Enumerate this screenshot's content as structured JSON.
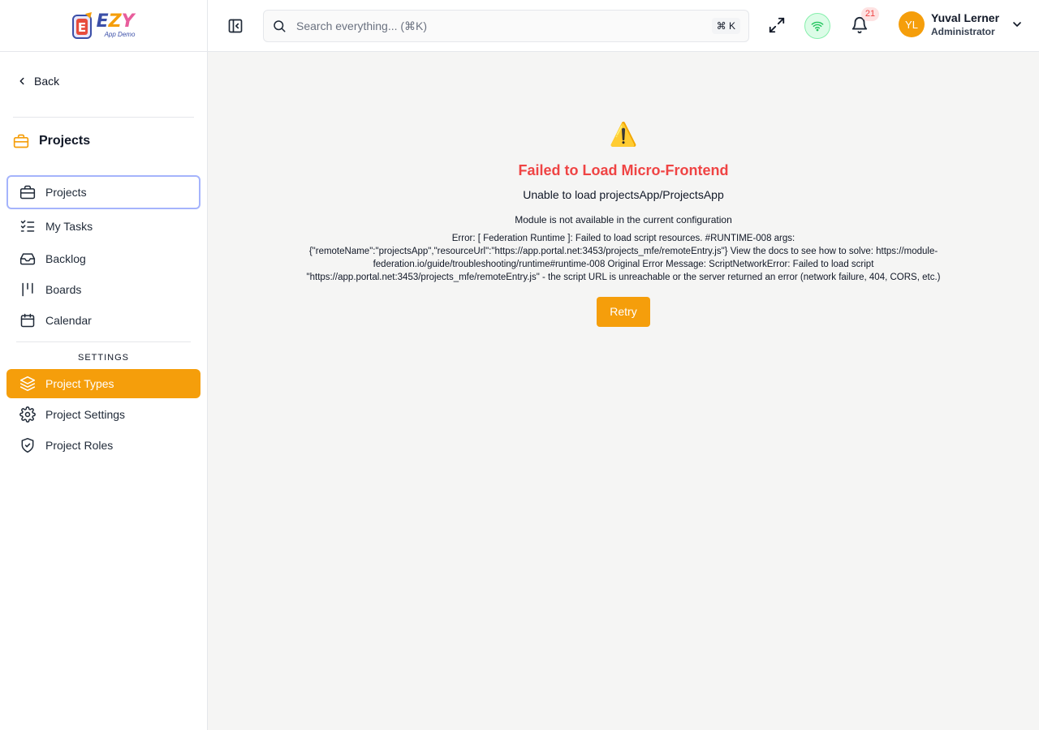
{
  "logo": {
    "word_e": "E",
    "word_z": "Z",
    "word_y": "Y",
    "subtitle": "App Demo",
    "mark": "E"
  },
  "sidebar": {
    "back_label": "Back",
    "section_title": "Projects",
    "items": [
      {
        "label": "Projects",
        "icon": "briefcase-icon"
      },
      {
        "label": "My Tasks",
        "icon": "list-checks-icon"
      },
      {
        "label": "Backlog",
        "icon": "inbox-icon"
      },
      {
        "label": "Boards",
        "icon": "kanban-icon"
      },
      {
        "label": "Calendar",
        "icon": "calendar-icon"
      }
    ],
    "settings_label": "SETTINGS",
    "settings_items": [
      {
        "label": "Project Types",
        "icon": "layers-icon"
      },
      {
        "label": "Project Settings",
        "icon": "gear-icon"
      },
      {
        "label": "Project Roles",
        "icon": "shield-check-icon"
      }
    ]
  },
  "header": {
    "search_placeholder": "Search everything... (⌘K)",
    "search_shortcut": "⌘ K",
    "notification_count": "21",
    "user": {
      "initials": "YL",
      "name": "Yuval Lerner",
      "role": "Administrator"
    }
  },
  "error": {
    "icon": "⚠️",
    "title": "Failed to Load Micro-Frontend",
    "subtitle": "Unable to load projectsApp/ProjectsApp",
    "module_message": "Module is not available in the current configuration",
    "detail": "Error: [ Federation Runtime ]: Failed to load script resources. #RUNTIME-008 args: {\"remoteName\":\"projectsApp\",\"resourceUrl\":\"https://app.portal.net:3453/projects_mfe/remoteEntry.js\"} View the docs to see how to solve: https://module-federation.io/guide/troubleshooting/runtime#runtime-008 Original Error Message: ScriptNetworkError: Failed to load script \"https://app.portal.net:3453/projects_mfe/remoteEntry.js\" - the script URL is unreachable or the server returned an error (network failure, 404, CORS, etc.)",
    "retry_label": "Retry"
  },
  "colors": {
    "accent": "#f59e0b",
    "error": "#ef4444",
    "focus_outline": "#a5b4fc",
    "online": "#22c55e"
  }
}
